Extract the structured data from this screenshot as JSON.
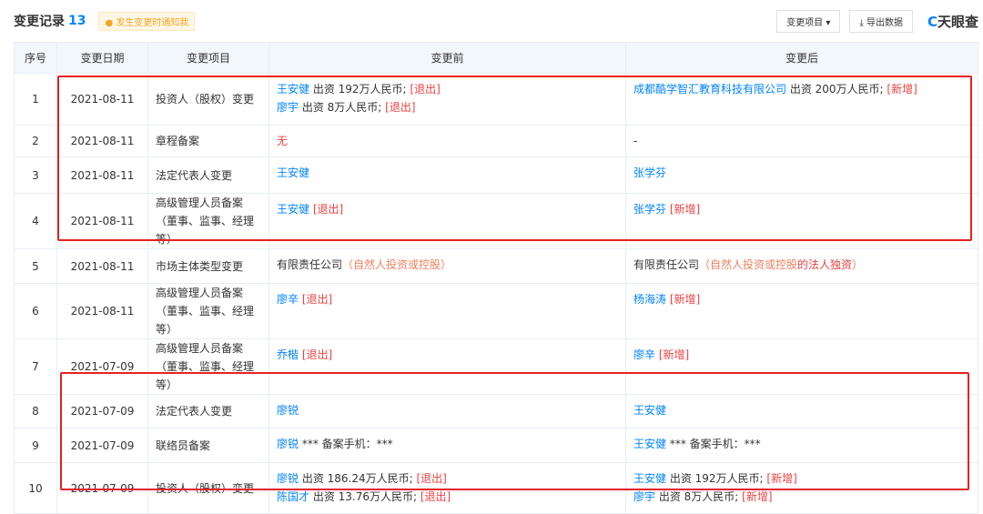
{
  "header": {
    "title": "变更记录",
    "count": "13",
    "notify": "发生变更时通知我",
    "filter": "变更项目 ▾",
    "export": "导出数据",
    "logo_mark": "C",
    "logo_text": "天眼查"
  },
  "columns": [
    "序号",
    "变更日期",
    "变更项目",
    "变更前",
    "变更后"
  ],
  "rows": [
    {
      "no": "1",
      "date": "2021-08-11",
      "item": "投资人（股权）变更",
      "before": [
        [
          {
            "t": "王安健",
            "c": "link"
          },
          {
            "t": " 出资 192万人民币; "
          },
          {
            "t": "[退出]",
            "c": "red"
          }
        ],
        [
          {
            "t": "廖宇",
            "c": "link"
          },
          {
            "t": " 出资 8万人民币; "
          },
          {
            "t": "[退出]",
            "c": "red"
          }
        ]
      ],
      "after": [
        [
          {
            "t": "成都酷学智汇教育科技有限公司",
            "c": "link"
          },
          {
            "t": " 出资 200万人民币; "
          },
          {
            "t": "[新增]",
            "c": "red"
          }
        ]
      ]
    },
    {
      "no": "2",
      "date": "2021-08-11",
      "item": "章程备案",
      "before": [
        [
          {
            "t": "无",
            "c": "red"
          }
        ]
      ],
      "after": [
        [
          {
            "t": "-"
          }
        ]
      ]
    },
    {
      "no": "3",
      "date": "2021-08-11",
      "item": "法定代表人变更",
      "before": [
        [
          {
            "t": "王安健",
            "c": "link"
          }
        ]
      ],
      "after": [
        [
          {
            "t": "张学芬",
            "c": "link"
          }
        ]
      ]
    },
    {
      "no": "4",
      "date": "2021-08-11",
      "item": "高级管理人员备案（董事、监事、经理等）",
      "before": [
        [
          {
            "t": "王安健",
            "c": "link"
          },
          {
            "t": " "
          },
          {
            "t": "[退出]",
            "c": "red"
          }
        ]
      ],
      "after": [
        [
          {
            "t": "张学芬",
            "c": "link"
          },
          {
            "t": " "
          },
          {
            "t": "[新增]",
            "c": "red"
          }
        ]
      ]
    },
    {
      "no": "5",
      "date": "2021-08-11",
      "item": "市场主体类型变更",
      "before": [
        [
          {
            "t": "有限责任公司"
          },
          {
            "t": "（自然人投资或控股）",
            "c": "paren"
          }
        ]
      ],
      "after": [
        [
          {
            "t": "有限责任公司"
          },
          {
            "t": "（自然人投资或控股",
            "c": "paren"
          },
          {
            "t": "的法人独资",
            "c": "red"
          },
          {
            "t": "）",
            "c": "paren"
          }
        ]
      ]
    },
    {
      "no": "6",
      "date": "2021-08-11",
      "item": "高级管理人员备案（董事、监事、经理等）",
      "before": [
        [
          {
            "t": "廖辛",
            "c": "link"
          },
          {
            "t": " "
          },
          {
            "t": "[退出]",
            "c": "red"
          }
        ]
      ],
      "after": [
        [
          {
            "t": "杨海涛",
            "c": "link"
          },
          {
            "t": " "
          },
          {
            "t": "[新增]",
            "c": "red"
          }
        ]
      ]
    },
    {
      "no": "7",
      "date": "2021-07-09",
      "item": "高级管理人员备案（董事、监事、经理等）",
      "before": [
        [
          {
            "t": "乔楷",
            "c": "link"
          },
          {
            "t": " "
          },
          {
            "t": "[退出]",
            "c": "red"
          }
        ]
      ],
      "after": [
        [
          {
            "t": "廖辛",
            "c": "link"
          },
          {
            "t": " "
          },
          {
            "t": "[新增]",
            "c": "red"
          }
        ]
      ]
    },
    {
      "no": "8",
      "date": "2021-07-09",
      "item": "法定代表人变更",
      "before": [
        [
          {
            "t": "廖锐",
            "c": "link"
          }
        ]
      ],
      "after": [
        [
          {
            "t": "王安健",
            "c": "link"
          }
        ]
      ]
    },
    {
      "no": "9",
      "date": "2021-07-09",
      "item": "联络员备案",
      "before": [
        [
          {
            "t": "廖锐",
            "c": "link"
          },
          {
            "t": " *** 备案手机：***"
          }
        ]
      ],
      "after": [
        [
          {
            "t": "王安健",
            "c": "link"
          },
          {
            "t": " *** 备案手机：***"
          }
        ]
      ]
    },
    {
      "no": "10",
      "date": "2021-07-09",
      "item": "投资人（股权）变更",
      "before": [
        [
          {
            "t": "廖锐",
            "c": "link"
          },
          {
            "t": " 出资 186.24万人民币; "
          },
          {
            "t": "[退出]",
            "c": "red"
          }
        ],
        [
          {
            "t": "陈国才",
            "c": "link"
          },
          {
            "t": " 出资 13.76万人民币; "
          },
          {
            "t": "[退出]",
            "c": "red"
          }
        ]
      ],
      "after": [
        [
          {
            "t": "王安健",
            "c": "link"
          },
          {
            "t": " 出资 192万人民币; "
          },
          {
            "t": "[新增]",
            "c": "red"
          }
        ],
        [
          {
            "t": "廖宇",
            "c": "link"
          },
          {
            "t": " 出资 8万人民币; "
          },
          {
            "t": "[新增]",
            "c": "red"
          }
        ]
      ]
    }
  ]
}
